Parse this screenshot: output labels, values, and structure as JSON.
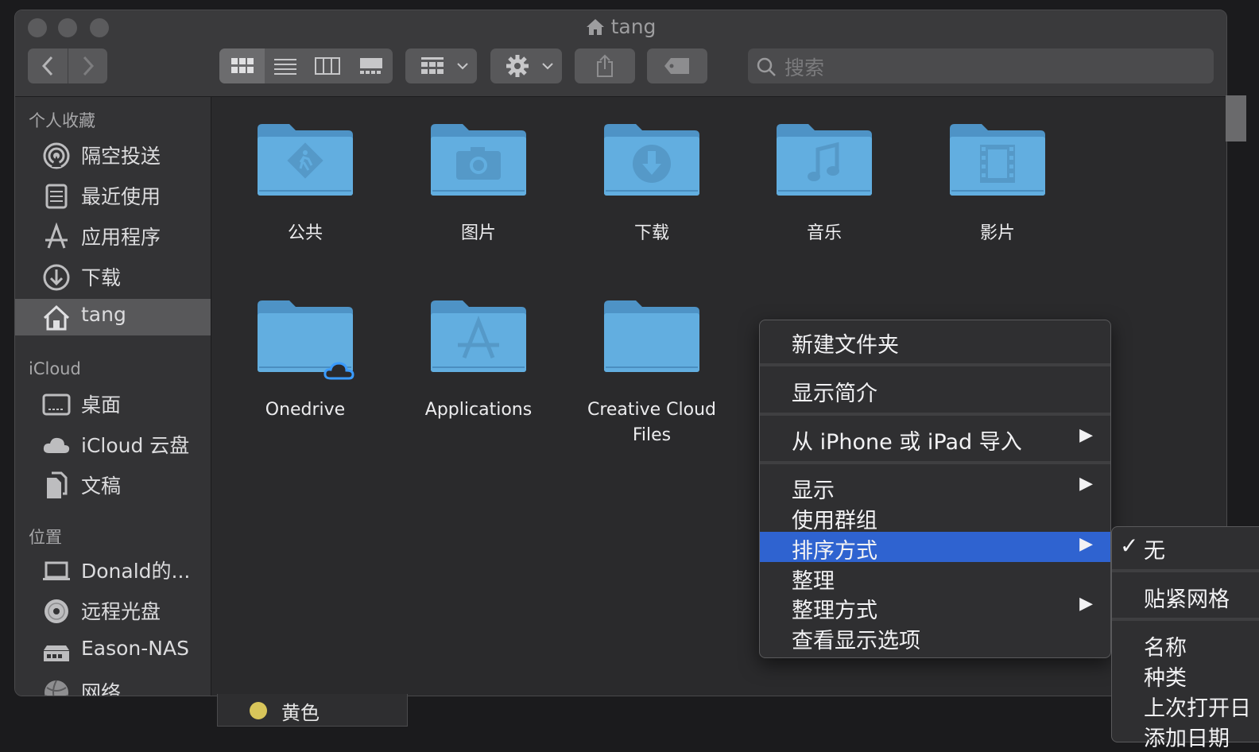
{
  "window": {
    "title": "tang",
    "title_icon": "home-icon"
  },
  "toolbar": {
    "back_icon": "chevron-left-icon",
    "forward_icon": "chevron-right-icon",
    "views": [
      "icon-view-icon",
      "list-view-icon",
      "column-view-icon",
      "gallery-view-icon"
    ],
    "group_icon": "group-by-icon",
    "action_icon": "gear-icon",
    "share_icon": "share-icon",
    "tag_icon": "tag-icon",
    "search_placeholder": "搜索"
  },
  "sidebar": {
    "sections": [
      {
        "header": "个人收藏",
        "items": [
          {
            "label": "隔空投送",
            "icon": "airdrop-icon"
          },
          {
            "label": "最近使用",
            "icon": "recents-icon"
          },
          {
            "label": "应用程序",
            "icon": "applications-icon"
          },
          {
            "label": "下载",
            "icon": "download-icon"
          },
          {
            "label": "tang",
            "icon": "home-icon",
            "selected": true
          }
        ]
      },
      {
        "header": "iCloud",
        "items": [
          {
            "label": "桌面",
            "icon": "desktop-icon"
          },
          {
            "label": "iCloud 云盘",
            "icon": "cloud-icon"
          },
          {
            "label": "文稿",
            "icon": "documents-icon"
          }
        ]
      },
      {
        "header": "位置",
        "items": [
          {
            "label": "Donald的...",
            "icon": "laptop-icon"
          },
          {
            "label": "远程光盘",
            "icon": "disc-icon"
          },
          {
            "label": "Eason-NAS",
            "icon": "server-icon"
          },
          {
            "label": "网络",
            "icon": "network-icon"
          }
        ]
      }
    ]
  },
  "files": [
    {
      "name": "公共",
      "glyph": "public-folder-icon"
    },
    {
      "name": "图片",
      "glyph": "pictures-folder-icon"
    },
    {
      "name": "下载",
      "glyph": "downloads-folder-icon"
    },
    {
      "name": "音乐",
      "glyph": "music-folder-icon"
    },
    {
      "name": "影片",
      "glyph": "movies-folder-icon"
    },
    {
      "name": "Onedrive",
      "glyph": "cloud-badge-icon"
    },
    {
      "name": "Applications",
      "glyph": "applications-folder-icon"
    },
    {
      "name": "Creative Cloud Files",
      "glyph": "folder-icon"
    }
  ],
  "context_menu": {
    "items": [
      {
        "label": "新建文件夹"
      },
      {
        "label": "显示简介"
      },
      {
        "label": "从 iPhone 或 iPad 导入",
        "submenu": true
      },
      {
        "label": "显示",
        "submenu": true
      },
      {
        "label": "使用群组"
      },
      {
        "label": "排序方式",
        "submenu": true,
        "highlighted": true
      },
      {
        "label": "整理"
      },
      {
        "label": "整理方式",
        "submenu": true
      },
      {
        "label": "查看显示选项"
      }
    ],
    "arrow": "▶"
  },
  "sort_submenu": {
    "check": "✓",
    "items": [
      {
        "label": "无",
        "checked": true
      },
      {
        "label": "贴紧网格"
      },
      {
        "label": "名称"
      },
      {
        "label": "种类"
      },
      {
        "label": "上次打开日"
      },
      {
        "label": "添加日期"
      }
    ]
  },
  "tags": {
    "visible_item": "黄色",
    "color": "#d8c55a"
  },
  "colors": {
    "accent": "#2f63d0",
    "folder": "#5aa4d8"
  }
}
